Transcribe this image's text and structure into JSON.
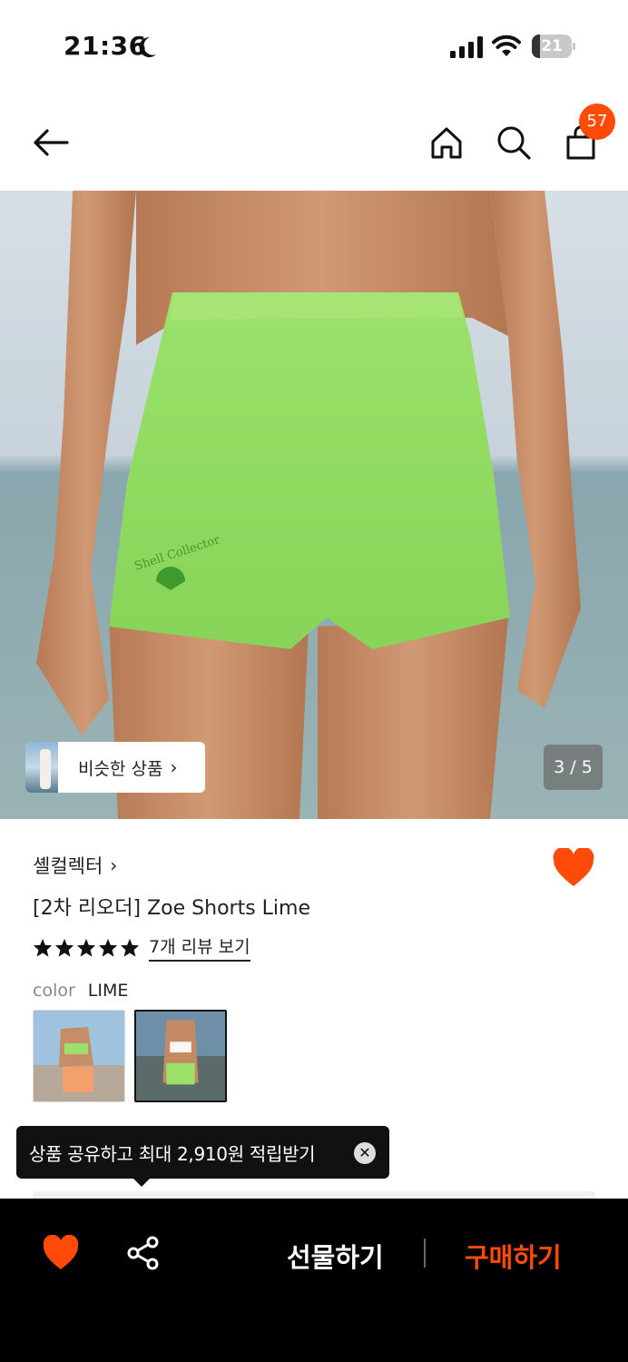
{
  "status_bar": {
    "time": "21:36",
    "battery": "21",
    "battery_level": 0.21
  },
  "header": {
    "cart_count": "57"
  },
  "gallery": {
    "similar_label": "비슷한 상품",
    "page_counter": "3 / 5"
  },
  "product": {
    "brand": "셸컬렉터",
    "name": "[2차 리오더] Zoe Shorts Lime",
    "rating_stars": 5,
    "review_link": "7개 리뷰 보기",
    "color_label": "color",
    "color_value": "LIME"
  },
  "tooltip": {
    "text": "상품 공유하고 최대 2,910원 적립받기"
  },
  "bottom_bar": {
    "gift_label": "선물하기",
    "buy_label": "구매하기"
  },
  "colors": {
    "accent": "#ff4a0a",
    "lime": "#8fd65a",
    "dark": "#000000"
  },
  "icons": [
    "moon-icon",
    "signal-icon",
    "wifi-icon",
    "battery-icon",
    "back-arrow-icon",
    "home-icon",
    "search-icon",
    "bag-icon",
    "chevron-right-icon",
    "heart-icon",
    "star-icon",
    "close-icon",
    "share-icon"
  ]
}
